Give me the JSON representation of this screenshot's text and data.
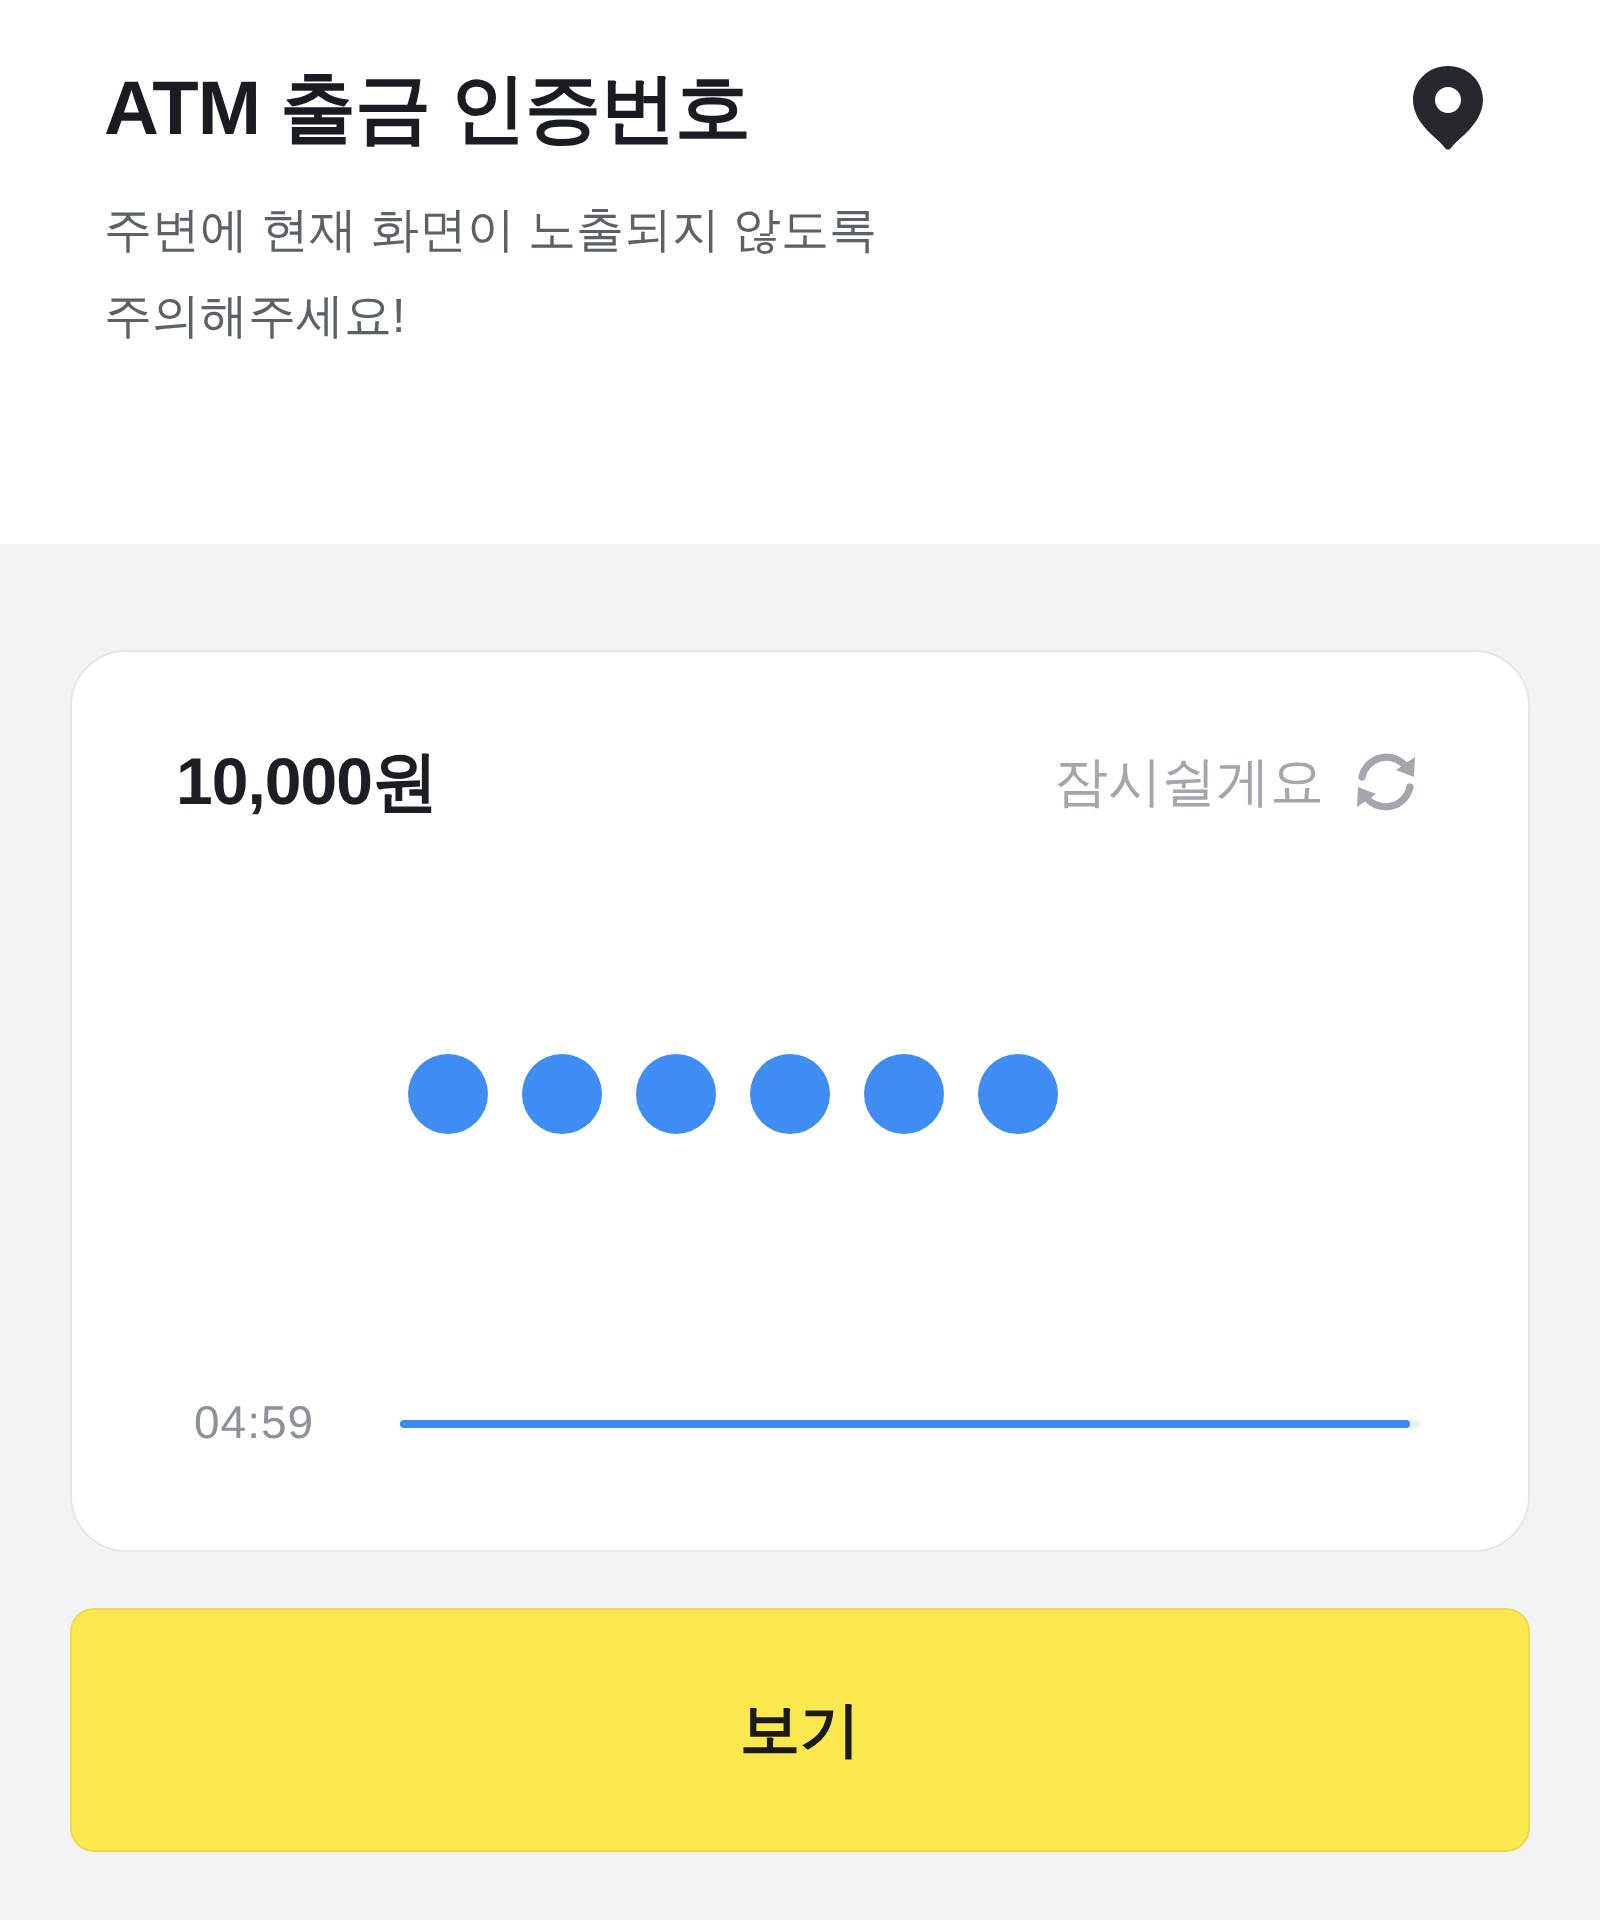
{
  "header": {
    "title": "ATM 출금 인증번호",
    "notice": "주변에 현재 화면이 노출되지 않도록\n주의해주세요!"
  },
  "card": {
    "amount": "10,000원",
    "pause_label": "잠시쉴게요",
    "code_dots": [
      {
        "filled": true
      },
      {
        "filled": true
      },
      {
        "filled": true
      },
      {
        "filled": true
      },
      {
        "filled": true
      },
      {
        "filled": true
      }
    ],
    "timer": {
      "time": "04:59",
      "level": 0.99
    }
  },
  "button": {
    "label": "보기"
  }
}
